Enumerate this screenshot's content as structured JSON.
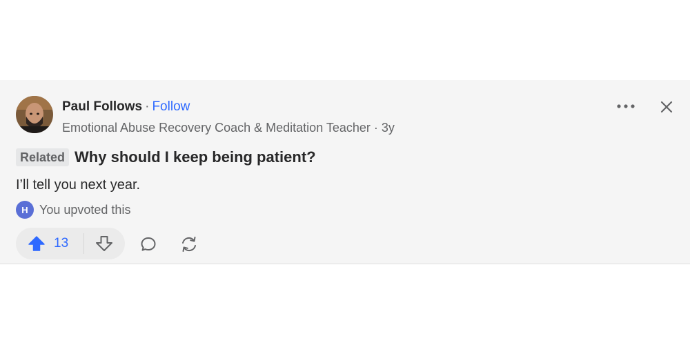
{
  "author": {
    "name": "Paul Follows",
    "separator": "·",
    "follow_label": "Follow",
    "credential": "Emotional Abuse Recovery Coach & Meditation Teacher · 3y"
  },
  "question": {
    "tag": "Related",
    "title": "Why should I keep being patient?"
  },
  "answer": {
    "text": "I’ll tell you next year."
  },
  "upvoted": {
    "avatar_initial": "H",
    "text": "You upvoted this"
  },
  "actions": {
    "upvote_count": "13"
  },
  "icons": {
    "more": "more-horizontal-icon",
    "close": "close-icon",
    "upvote": "upvote-arrow-icon",
    "downvote": "downvote-arrow-icon",
    "comment": "comment-icon",
    "share": "share-icon"
  },
  "colors": {
    "accent": "#2e69ff",
    "card_background": "#f5f5f5",
    "muted_text": "#636466",
    "mini_avatar": "#5a6fd6"
  }
}
